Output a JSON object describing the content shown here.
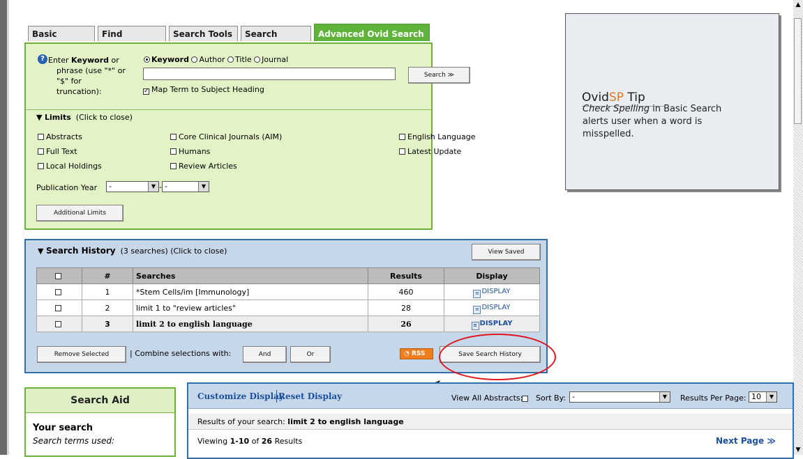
{
  "tabs": [
    "Basic Search",
    "Find Citation",
    "Search Tools",
    "Search Fields",
    "Advanced Ovid Search"
  ],
  "search": {
    "help_icon": "question-circle-icon",
    "label_parts": [
      "Enter ",
      "Keyword",
      " or",
      "phrase (use \"*\" or",
      "\"$\" for",
      "truncation):"
    ],
    "radios": [
      {
        "label": "Keyword",
        "checked": true
      },
      {
        "label": "Author",
        "checked": false
      },
      {
        "label": "Title",
        "checked": false
      },
      {
        "label": "Journal",
        "checked": false
      }
    ],
    "input_value": "",
    "search_button": "Search ≫",
    "map_term_label": "Map Term to Subject Heading",
    "map_term_checked": true
  },
  "limits": {
    "title": "Limits",
    "toggle_text": "(Click to close)",
    "col1": [
      "Abstracts",
      "Full Text",
      "Local Holdings"
    ],
    "col2": [
      "Core Clinical Journals (AIM)",
      "Humans",
      "Review Articles"
    ],
    "col3": [
      "English Language",
      "Latest Update"
    ],
    "pub_year_label": "Publication Year",
    "pub_year_from": "-",
    "pub_year_to": "-",
    "additional_button": "Additional Limits"
  },
  "tip": {
    "title_a": "Ovid",
    "title_b": "SP",
    "title_c": " Tip",
    "body_em": "Check Spelling",
    "body_rest": " in Basic Search alerts user when a word is misspelled."
  },
  "history": {
    "title": "Search History",
    "count_text": "(3 searches) (Click to close)",
    "view_saved": "View Saved",
    "headers": [
      "#",
      "Searches",
      "Results",
      "Display"
    ],
    "rows": [
      {
        "num": "1",
        "search": "*Stem Cells/im [Immunology]",
        "results": "460",
        "display": "DISPLAY"
      },
      {
        "num": "2",
        "search": "limit 1 to \"review articles\"",
        "results": "28",
        "display": "DISPLAY"
      },
      {
        "num": "3",
        "search": "limit 2 to english language",
        "results": "26",
        "display": "DISPLAY"
      }
    ],
    "remove_selected": "Remove Selected",
    "combine_text": "| Combine selections with:",
    "and_button": "And",
    "or_button": "Or",
    "rss": "RSS",
    "save_history": "Save Search History"
  },
  "aid": {
    "title": "Search Aid",
    "your_search": "Your search",
    "terms_used": "Search terms used:"
  },
  "results": {
    "customize": "Customize Display",
    "reset": "Reset Display",
    "view_abstracts": "View All Abstracts:",
    "sort_by": "Sort By:",
    "sort_value": "-",
    "per_page_label": "Results Per Page:",
    "per_page_value": "10",
    "results_of_prefix": "Results of your search:",
    "results_of_query": "limit 2 to english language",
    "viewing_a": "Viewing ",
    "viewing_b": "1-10",
    "viewing_c": " of ",
    "viewing_d": "26",
    "viewing_e": " Results",
    "next_page": "Next Page ≫"
  },
  "colors": {
    "green_accent": "#5fb33a",
    "blue_accent": "#2f6fb0",
    "annotation_red": "#e0161c"
  }
}
